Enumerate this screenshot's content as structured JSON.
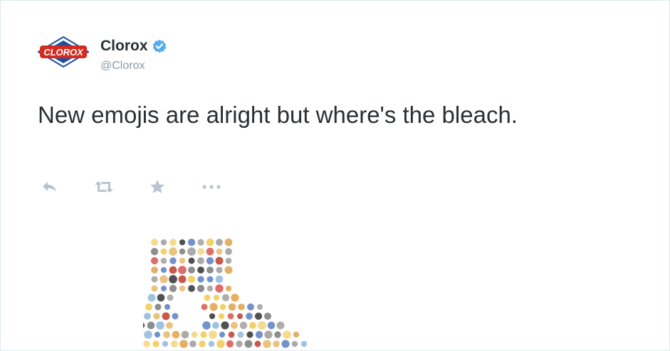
{
  "tweet": {
    "author": {
      "display_name": "Clorox",
      "handle": "@Clorox",
      "verified": true,
      "avatar_logo_text": "CLOROX",
      "avatar_icon": "clorox-diamond-logo"
    },
    "text": "New emojis are alright but where's the bleach.",
    "actions": [
      {
        "name": "reply",
        "icon": "reply-icon"
      },
      {
        "name": "retweet",
        "icon": "retweet-icon"
      },
      {
        "name": "favorite",
        "icon": "star-icon"
      },
      {
        "name": "more",
        "icon": "ellipsis-icon"
      }
    ],
    "media": {
      "icon": "emoji-collage-bleach-bottle"
    }
  },
  "colors": {
    "text": "#292f33",
    "muted": "#8899a6",
    "action_icon": "#b8c4cf",
    "verified_blue": "#55acee",
    "brand_blue": "#1d4fa3",
    "brand_red": "#d52b1e"
  }
}
